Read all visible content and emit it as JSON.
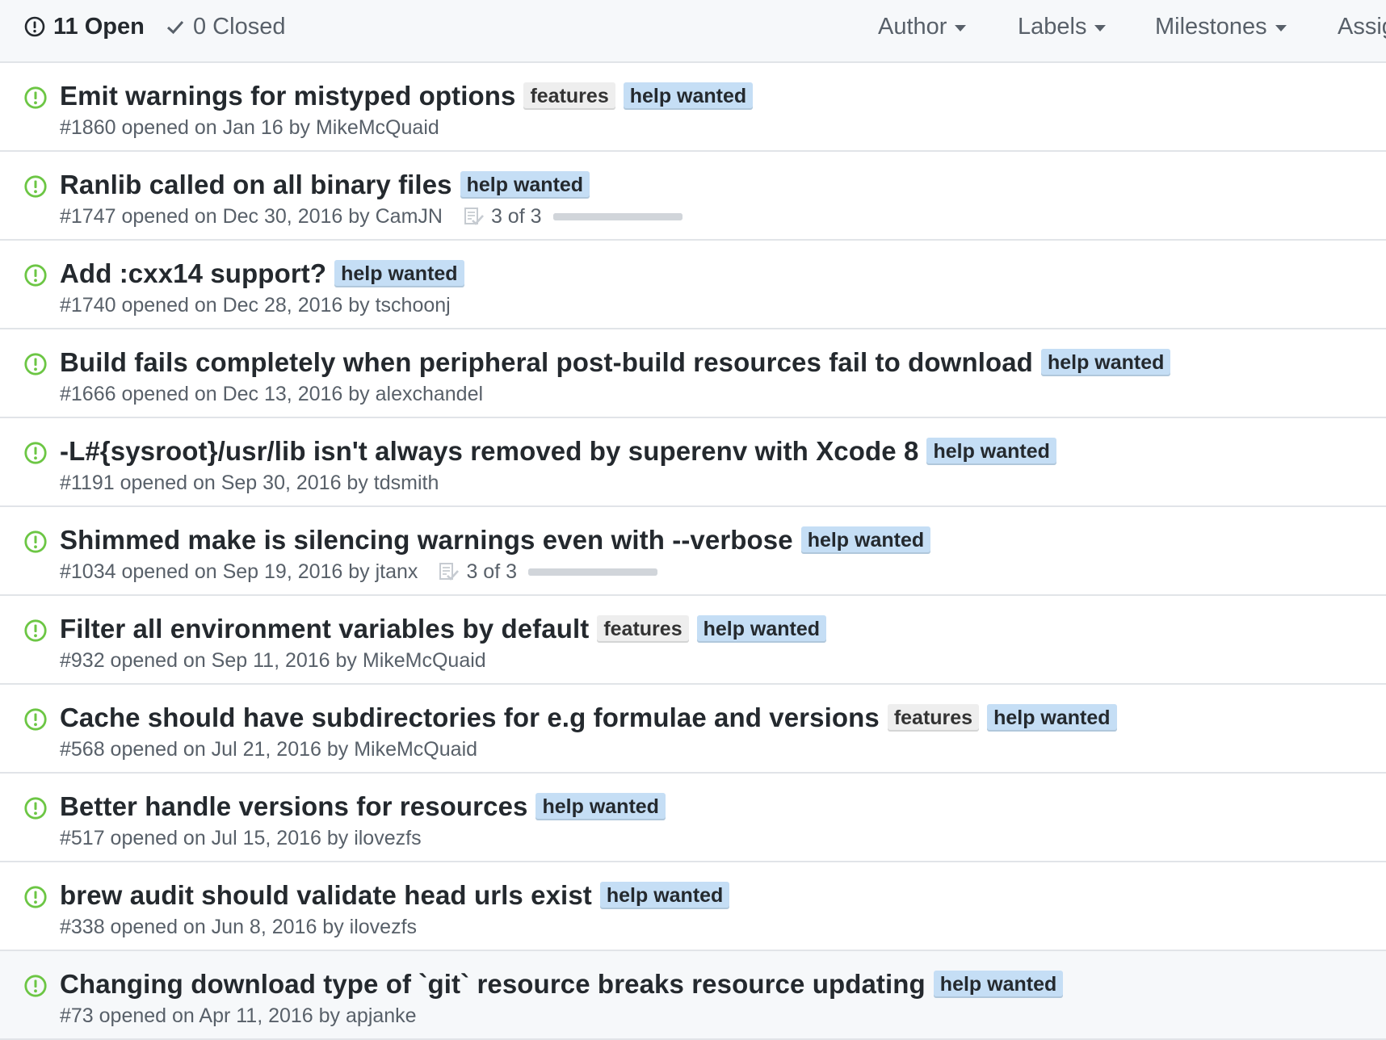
{
  "header": {
    "open": {
      "count_label": "11 Open"
    },
    "closed": {
      "count_label": "0 Closed"
    },
    "filters": [
      {
        "label": "Author"
      },
      {
        "label": "Labels"
      },
      {
        "label": "Milestones"
      },
      {
        "label": "Assignee"
      }
    ]
  },
  "colors": {
    "open_icon": "#6cc644",
    "features_label": "#eeeeee",
    "help_wanted_label": "#c5def5"
  },
  "issues": [
    {
      "title": "Emit warnings for mistyped options",
      "labels": [
        "features",
        "help wanted"
      ],
      "meta": "#1860 opened on Jan 16 by ",
      "author": "MikeMcQuaid",
      "tasks": null
    },
    {
      "title": "Ranlib called on all binary files",
      "labels": [
        "help wanted"
      ],
      "meta": "#1747 opened on Dec 30, 2016 by ",
      "author": "CamJN",
      "tasks": {
        "text": "3 of 3",
        "progress": 1.0
      }
    },
    {
      "title": "Add :cxx14 support?",
      "labels": [
        "help wanted"
      ],
      "meta": "#1740 opened on Dec 28, 2016 by ",
      "author": "tschoonj",
      "tasks": null
    },
    {
      "title": "Build fails completely when peripheral post-build resources fail to download",
      "labels": [
        "help wanted"
      ],
      "meta": "#1666 opened on Dec 13, 2016 by ",
      "author": "alexchandel",
      "tasks": null
    },
    {
      "title": "-L#{sysroot}/usr/lib isn't always removed by superenv with Xcode 8",
      "labels": [
        "help wanted"
      ],
      "meta": "#1191 opened on Sep 30, 2016 by ",
      "author": "tdsmith",
      "tasks": null
    },
    {
      "title": "Shimmed make is silencing warnings even with --verbose",
      "labels": [
        "help wanted"
      ],
      "meta": "#1034 opened on Sep 19, 2016 by ",
      "author": "jtanx",
      "tasks": {
        "text": "3 of 3",
        "progress": 1.0
      }
    },
    {
      "title": "Filter all environment variables by default",
      "labels": [
        "features",
        "help wanted"
      ],
      "meta": "#932 opened on Sep 11, 2016 by ",
      "author": "MikeMcQuaid",
      "tasks": null
    },
    {
      "title": "Cache should have subdirectories for e.g formulae and versions",
      "labels": [
        "features",
        "help wanted"
      ],
      "meta": "#568 opened on Jul 21, 2016 by ",
      "author": "MikeMcQuaid",
      "tasks": null
    },
    {
      "title": "Better handle versions for resources",
      "labels": [
        "help wanted"
      ],
      "meta": "#517 opened on Jul 15, 2016 by ",
      "author": "ilovezfs",
      "tasks": null
    },
    {
      "title": "brew audit should validate head urls exist",
      "labels": [
        "help wanted"
      ],
      "meta": "#338 opened on Jun 8, 2016 by ",
      "author": "ilovezfs",
      "tasks": null
    },
    {
      "title": "Changing download type of `git` resource breaks resource updating",
      "labels": [
        "help wanted"
      ],
      "meta": "#73 opened on Apr 11, 2016 by ",
      "author": "apjanke",
      "tasks": null,
      "hovered": true
    }
  ],
  "icons": {
    "open_filter": "issue-opened-icon",
    "closed_filter": "check-icon",
    "row": "issue-opened-icon",
    "tasks": "checklist-icon",
    "dropdown": "triangle-down-icon"
  }
}
